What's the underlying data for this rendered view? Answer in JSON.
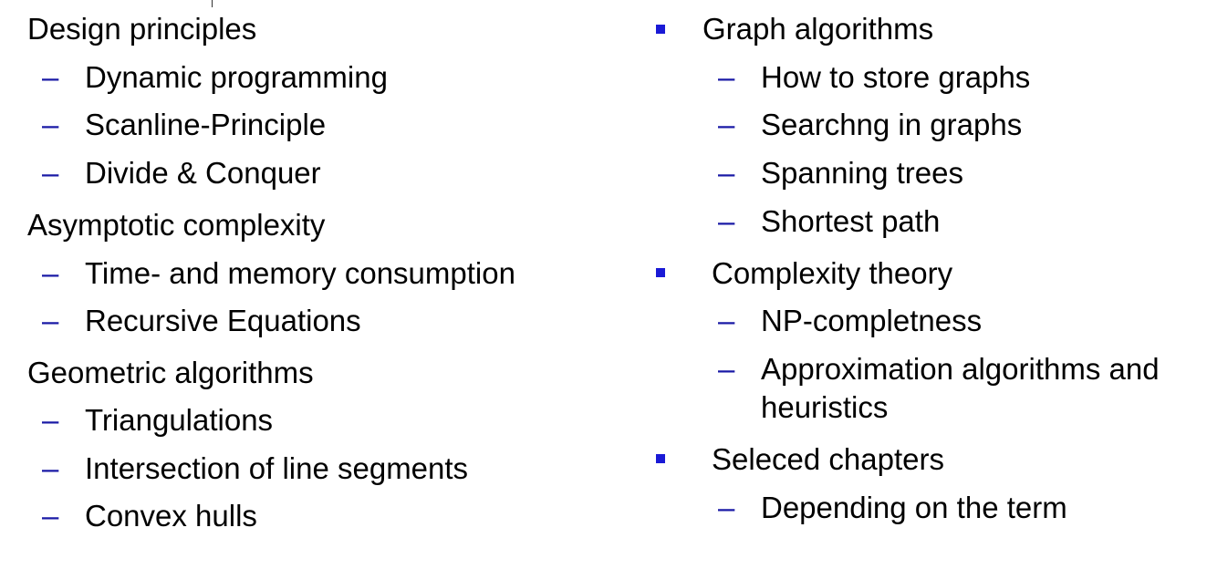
{
  "left": {
    "sections": [
      {
        "title": "Design principles",
        "items": [
          "Dynamic programming",
          "Scanline-Principle",
          "Divide & Conquer"
        ]
      },
      {
        "title": "Asymptotic complexity",
        "items": [
          "Time- and memory consumption",
          "Recursive Equations"
        ]
      },
      {
        "title": "Geometric algorithms",
        "items": [
          "Triangulations",
          "Intersection of line segments",
          "Convex hulls"
        ]
      }
    ]
  },
  "right": {
    "sections": [
      {
        "title": "Graph algorithms",
        "items": [
          "How to store graphs",
          "Searchng in graphs",
          "Spanning trees",
          "Shortest path"
        ]
      },
      {
        "title": "Complexity theory",
        "items": [
          "NP-completness",
          "Approximation algorithms and",
          "heuristics"
        ]
      },
      {
        "title": "Seleced chapters",
        "items": [
          "Depending on the term"
        ]
      }
    ]
  },
  "colors": {
    "text": "#000000",
    "marker": "#1a1ad6"
  },
  "icons": {
    "sub_marker": "en-dash",
    "right_top_marker": "square-bullet"
  }
}
